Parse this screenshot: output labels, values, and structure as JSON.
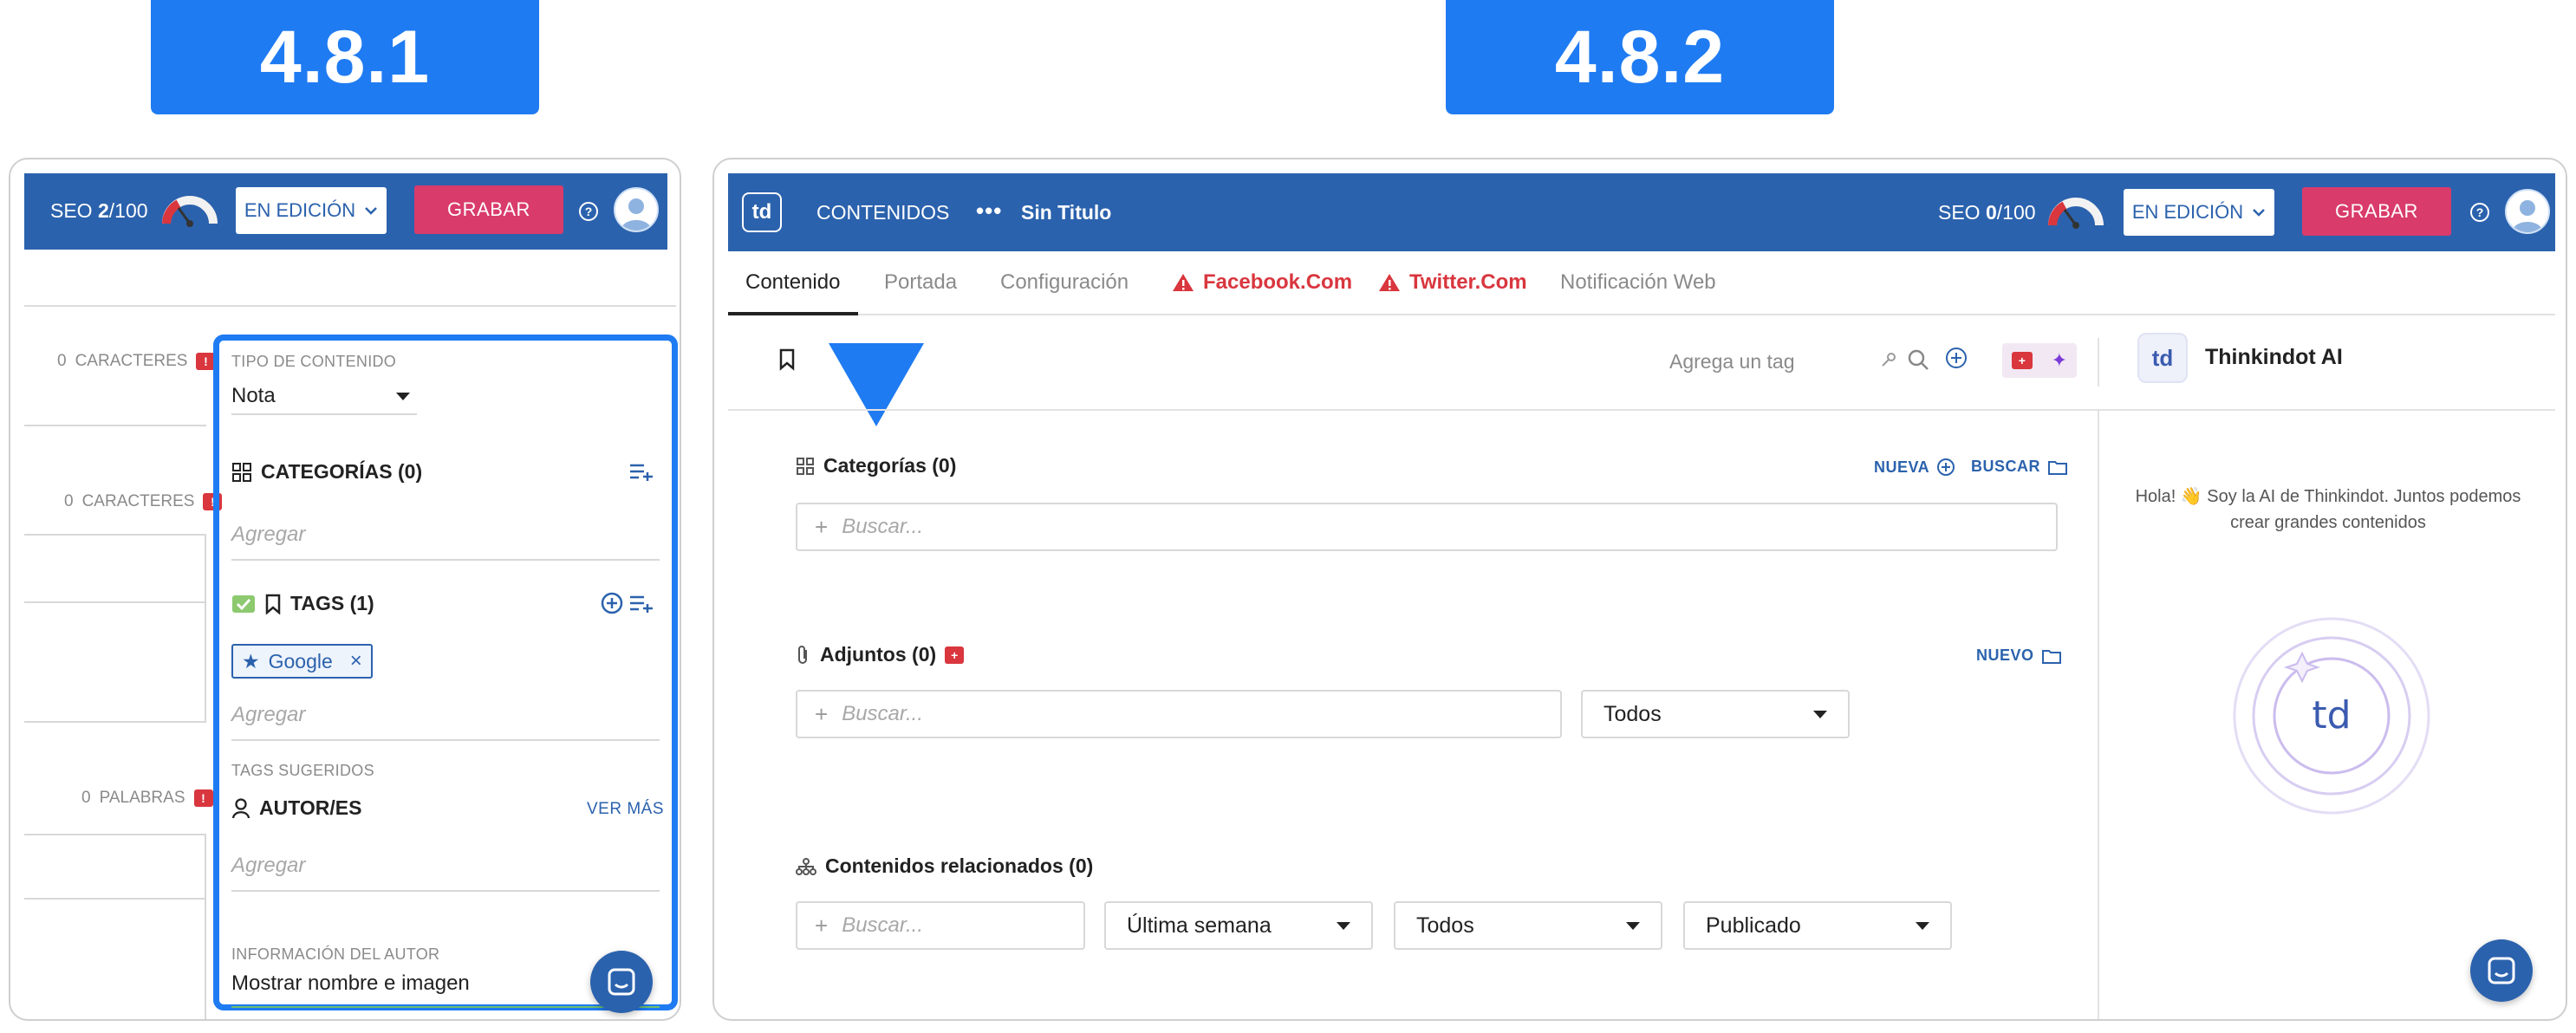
{
  "versions": {
    "left": "4.8.1",
    "right": "4.8.2"
  },
  "left_panel": {
    "header": {
      "seo_label": "SEO ",
      "seo_score": "2",
      "seo_total": "/100",
      "status": "EN EDICIÓN",
      "save": "GRABAR",
      "help": "?"
    },
    "counters": [
      {
        "count": "0",
        "unit": "CARACTERES",
        "flag": "!"
      },
      {
        "count": "0",
        "unit": "CARACTERES",
        "flag": "!"
      },
      {
        "count": "0",
        "unit": "PALABRAS",
        "flag": "!"
      }
    ],
    "content_type": {
      "label": "TIPO DE CONTENIDO",
      "value": "Nota"
    },
    "categories": {
      "title": "CATEGORÍAS (0)",
      "placeholder": "Agregar"
    },
    "tags": {
      "title": "TAGS (1)",
      "chip": "Google",
      "chip_close": "×",
      "placeholder": "Agregar",
      "suggested": "TAGS SUGERIDOS"
    },
    "authors": {
      "title": "AUTOR/ES",
      "more": "VER MÁS",
      "placeholder": "Agregar"
    },
    "author_info": {
      "label": "INFORMACIÓN DEL AUTOR",
      "value": "Mostrar nombre e imagen"
    }
  },
  "right_panel": {
    "header": {
      "logo": "td",
      "menu": "CONTENIDOS",
      "dots": "•••",
      "title": "Sin Titulo",
      "seo_label": "SEO ",
      "seo_score": "0",
      "seo_total": "/100",
      "status": "EN EDICIÓN",
      "save": "GRABAR",
      "help": "?"
    },
    "tabs": [
      "Contenido",
      "Portada",
      "Configuración",
      "Facebook.Com",
      "Twitter.Com",
      "Notificación Web"
    ],
    "tag_placeholder": "Agrega un tag",
    "ai": {
      "name": "Thinkindot AI",
      "logo": "td",
      "greeting": "Hola! 👋 Soy la AI de Thinkindot. Juntos podemos crear grandes contenidos"
    },
    "categories": {
      "title": "Categorías (0)",
      "new": "NUEVA",
      "search": "BUSCAR",
      "placeholder": "Buscar..."
    },
    "attachments": {
      "title": "Adjuntos (0)",
      "new": "NUEVO",
      "placeholder": "Buscar...",
      "filter": "Todos"
    },
    "related": {
      "title": "Contenidos relacionados (0)",
      "placeholder": "Buscar...",
      "period": "Última semana",
      "type": "Todos",
      "state": "Publicado"
    }
  },
  "colors": {
    "badge": "#1f7bf2",
    "header": "#2b62ad",
    "save": "#d93b6b",
    "alert": "#d9363e",
    "highlight": "#1f7bf2"
  }
}
